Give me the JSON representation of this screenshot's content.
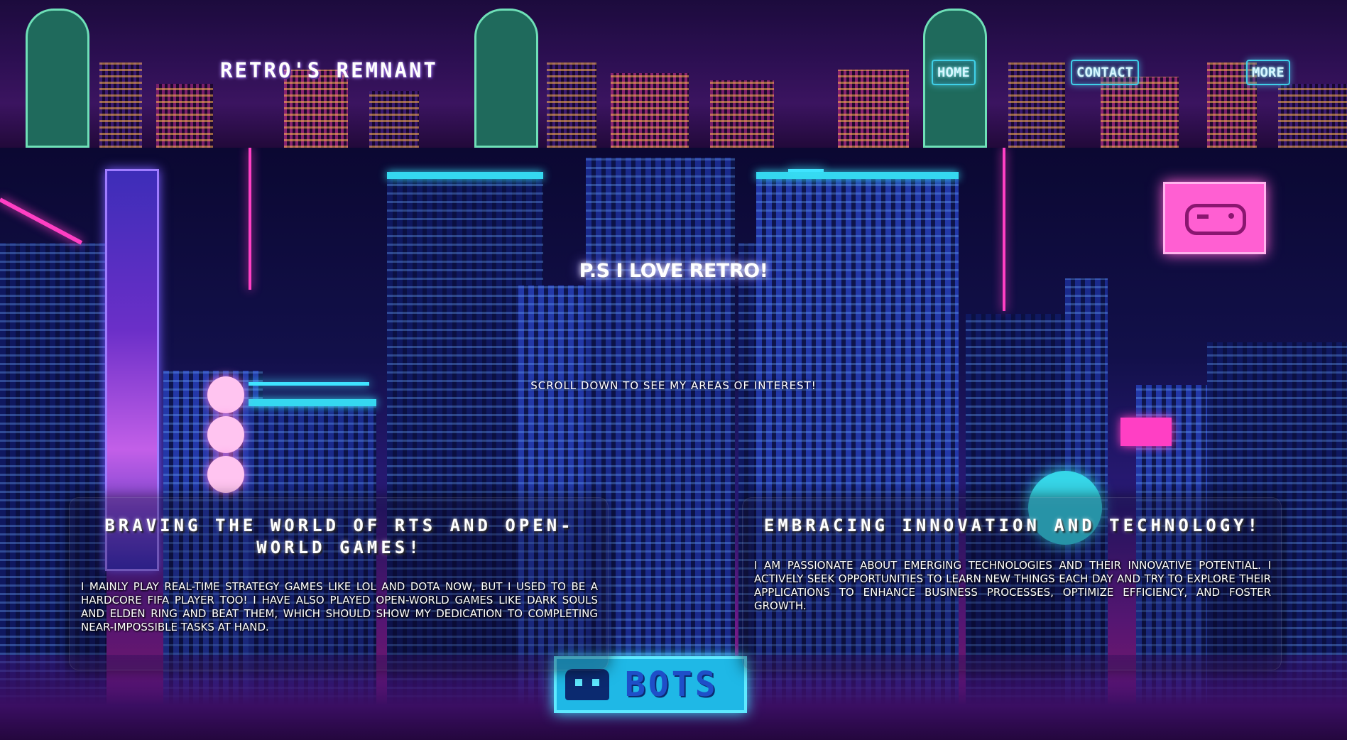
{
  "header": {
    "site_title": "RETRO'S REMNANT",
    "nav": [
      {
        "label": "HOME"
      },
      {
        "label": "CONTACT"
      },
      {
        "label": "MORE"
      }
    ]
  },
  "hero": {
    "heading": "P.S I LOVE RETRO!",
    "subheading": "SCROLL DOWN TO SEE MY AREAS OF INTEREST!",
    "sign_text": "BOTS"
  },
  "cards": [
    {
      "title": "BRAVING THE WORLD OF RTS AND OPEN-WORLD GAMES!",
      "text": "I mainly play real-time strategy games like LoL and Dota now, but I used to be a hardcore FIFA player too! I have also played open-world games like Dark Souls and Elden Ring and beat them, which should show my dedication to completing near-impossible tasks at hand."
    },
    {
      "title": "EMBRACING INNOVATION AND TECHNOLOGY!",
      "text": "I am passionate about emerging technologies and their innovative potential. I actively seek opportunities to learn new things each day and try to explore their applications to enhance business processes, optimize efficiency, and foster growth."
    }
  ],
  "colors": {
    "neon_cyan": "#3fe4ff",
    "neon_pink": "#ff3fc4",
    "night_blue": "#1a2a8c",
    "text": "#ffffff"
  }
}
